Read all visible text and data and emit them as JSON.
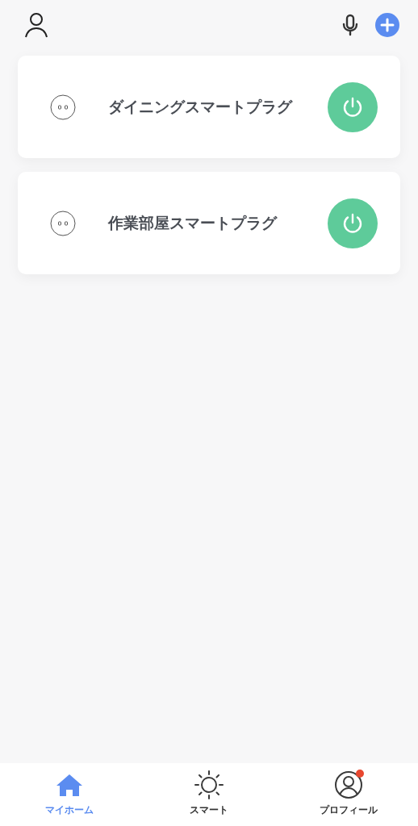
{
  "devices": [
    {
      "name": "ダイニングスマートプラグ",
      "on": true
    },
    {
      "name": "作業部屋スマートプラグ",
      "on": true
    }
  ],
  "tabs": [
    {
      "label": "マイホーム",
      "kind": "home",
      "selected": true,
      "notification": false
    },
    {
      "label": "スマート",
      "kind": "smart",
      "selected": false,
      "notification": false
    },
    {
      "label": "プロフィール",
      "kind": "profile",
      "selected": false,
      "notification": true
    }
  ]
}
